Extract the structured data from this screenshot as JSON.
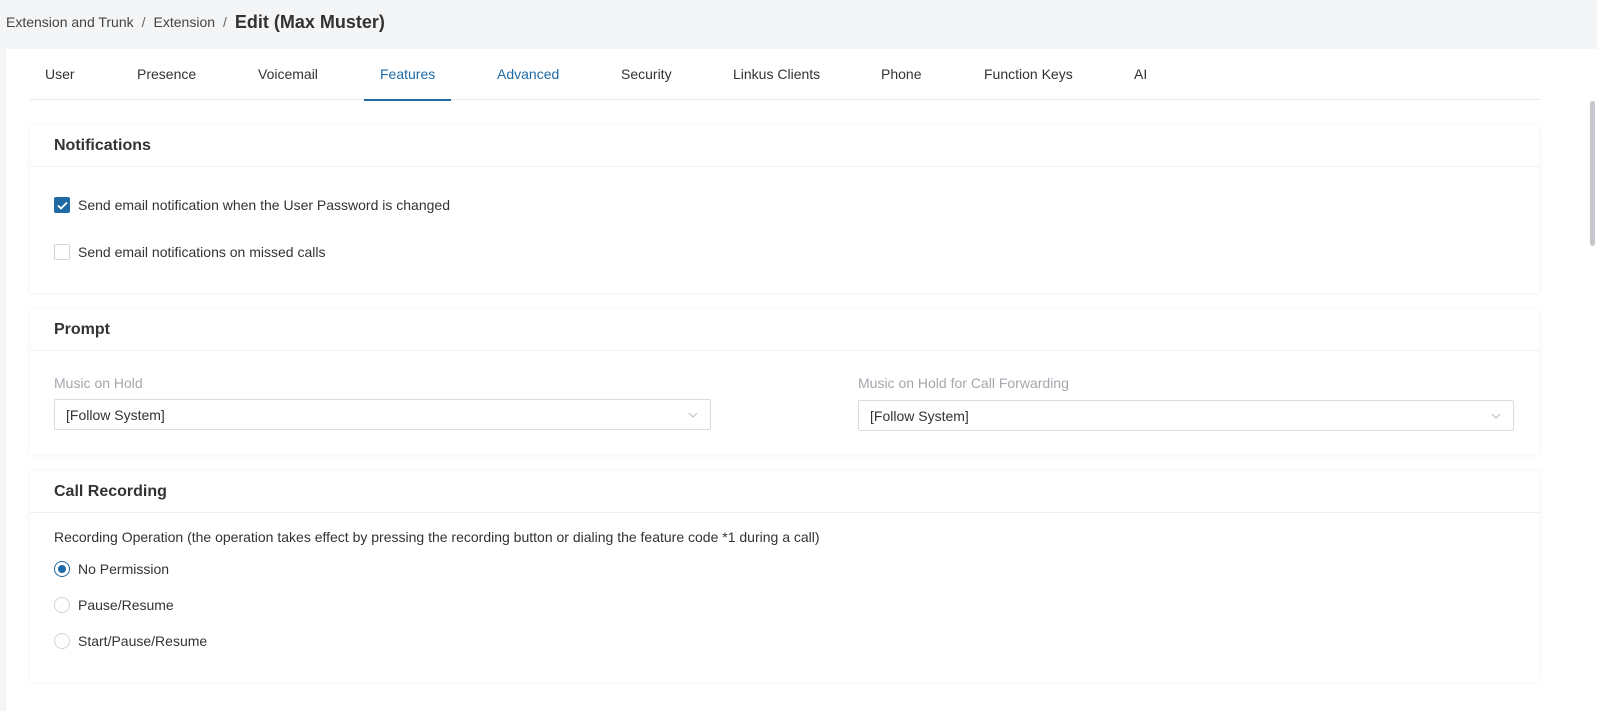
{
  "breadcrumb": {
    "items": [
      "Extension and Trunk",
      "Extension"
    ],
    "separator": "/",
    "current": "Edit (Max Muster)"
  },
  "tabs": [
    {
      "label": "User",
      "state": "normal"
    },
    {
      "label": "Presence",
      "state": "normal"
    },
    {
      "label": "Voicemail",
      "state": "normal"
    },
    {
      "label": "Features",
      "state": "active"
    },
    {
      "label": "Advanced",
      "state": "hover"
    },
    {
      "label": "Security",
      "state": "normal"
    },
    {
      "label": "Linkus Clients",
      "state": "normal"
    },
    {
      "label": "Phone",
      "state": "normal"
    },
    {
      "label": "Function Keys",
      "state": "normal"
    },
    {
      "label": "AI",
      "state": "normal"
    }
  ],
  "notifications": {
    "title": "Notifications",
    "options": [
      {
        "label": "Send email notification when the User Password is changed",
        "checked": true
      },
      {
        "label": "Send email notifications on missed calls",
        "checked": false
      }
    ]
  },
  "prompt": {
    "title": "Prompt",
    "music_on_hold": {
      "label": "Music on Hold",
      "value": "[Follow System]"
    },
    "music_on_hold_forwarding": {
      "label": "Music on Hold for Call Forwarding",
      "value": "[Follow System]"
    }
  },
  "call_recording": {
    "title": "Call Recording",
    "description": "Recording Operation (the operation takes effect by pressing the recording button or dialing the feature code *1 during a call)",
    "options": [
      {
        "label": "No Permission",
        "selected": true
      },
      {
        "label": "Pause/Resume",
        "selected": false
      },
      {
        "label": "Start/Pause/Resume",
        "selected": false
      }
    ]
  },
  "colors": {
    "accent": "#1f6aa5",
    "page_bg": "#f3f5f7",
    "label_muted": "#a3a8ae"
  }
}
